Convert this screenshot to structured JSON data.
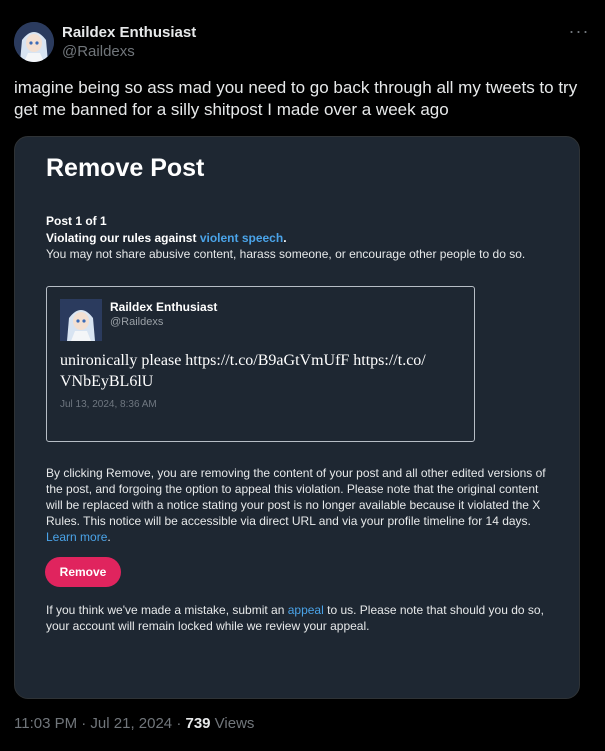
{
  "author": {
    "name": "Raildex Enthusiast",
    "handle": "@Raildexs"
  },
  "more_label": "···",
  "tweet": {
    "text": "imagine being so ass mad you need to go back through all my tweets to try get me banned for a silly shitpost I made over a week ago"
  },
  "card": {
    "title": "Remove Post",
    "post_count": "Post 1 of 1",
    "violating_prefix": "Violating our rules against ",
    "violating_link": "violent speech",
    "violating_suffix": ".",
    "rule_description": "You may not share abusive content, harass someone, or encourage other people to do so.",
    "quoted": {
      "name": "Raildex Enthusiast",
      "handle": "@Raildexs",
      "text_line1": "unironically please https://t.co/B9aGtVmUfF https://t.co/",
      "text_line2": "VNbEyBL6lU",
      "date": "Jul 13, 2024, 8:36 AM"
    },
    "explanation": "By clicking Remove, you are removing the content of your post and all other edited versions of the post, and forgoing the option to appeal this violation. Please note that the original content will be replaced with a notice stating your post is no longer available because it violated the X Rules. This notice will be accessible via direct URL and via your profile timeline for 14 days. ",
    "learn_more": "Learn more",
    "explanation_end": ".",
    "remove_label": "Remove",
    "appeal_prefix": "If you think we've made a mistake, submit an ",
    "appeal_link": "appeal",
    "appeal_suffix": " to us. Please note that should you do so, your account will remain locked while we review your appeal."
  },
  "footer": {
    "time_date": "11:03 PM · Jul 21, 2024 · ",
    "views_count": "739",
    "views_label": " Views"
  },
  "colors": {
    "background": "#000000",
    "card": "#1e2732",
    "link": "#4aa3e8",
    "remove_button": "#e0245e"
  }
}
